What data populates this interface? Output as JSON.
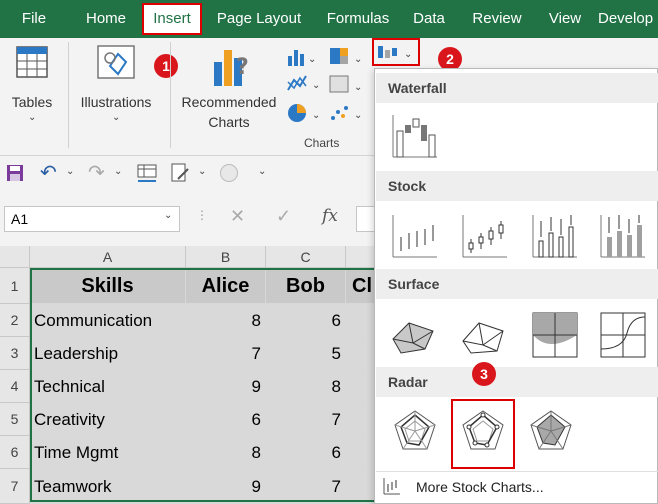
{
  "menu": {
    "tabs": [
      "File",
      "Home",
      "Insert",
      "Page Layout",
      "Formulas",
      "Data",
      "Review",
      "View",
      "Develop"
    ],
    "active": "Insert"
  },
  "ribbon": {
    "tables_label": "Tables",
    "illustrations_label": "Illustrations",
    "recommended_line1": "Recommended",
    "recommended_line2": "Charts",
    "charts_group_label": "Charts",
    "badge1": "1",
    "badge2": "2",
    "badge3": "3"
  },
  "namebox": {
    "value": "A1"
  },
  "formula": {
    "fx": "fx",
    "cancel": "✕",
    "enter": "✓"
  },
  "grid": {
    "columns": [
      "A",
      "B",
      "C"
    ],
    "rows": [
      "1",
      "2",
      "3",
      "4",
      "5",
      "6",
      "7"
    ],
    "headers": [
      "Skills",
      "Alice",
      "Bob",
      "Cl"
    ],
    "data": [
      {
        "skill": "Communication",
        "alice": "8",
        "bob": "6"
      },
      {
        "skill": "Leadership",
        "alice": "7",
        "bob": "5"
      },
      {
        "skill": "Technical",
        "alice": "9",
        "bob": "8"
      },
      {
        "skill": "Creativity",
        "alice": "6",
        "bob": "7"
      },
      {
        "skill": "Time Mgmt",
        "alice": "8",
        "bob": "6"
      },
      {
        "skill": "Teamwork",
        "alice": "9",
        "bob": "7"
      }
    ]
  },
  "panel": {
    "sections": [
      "Waterfall",
      "Stock",
      "Surface",
      "Radar"
    ],
    "more": "More Stock Charts..."
  },
  "colors": {
    "excel_green": "#217346",
    "highlight_red": "#dd0000"
  }
}
